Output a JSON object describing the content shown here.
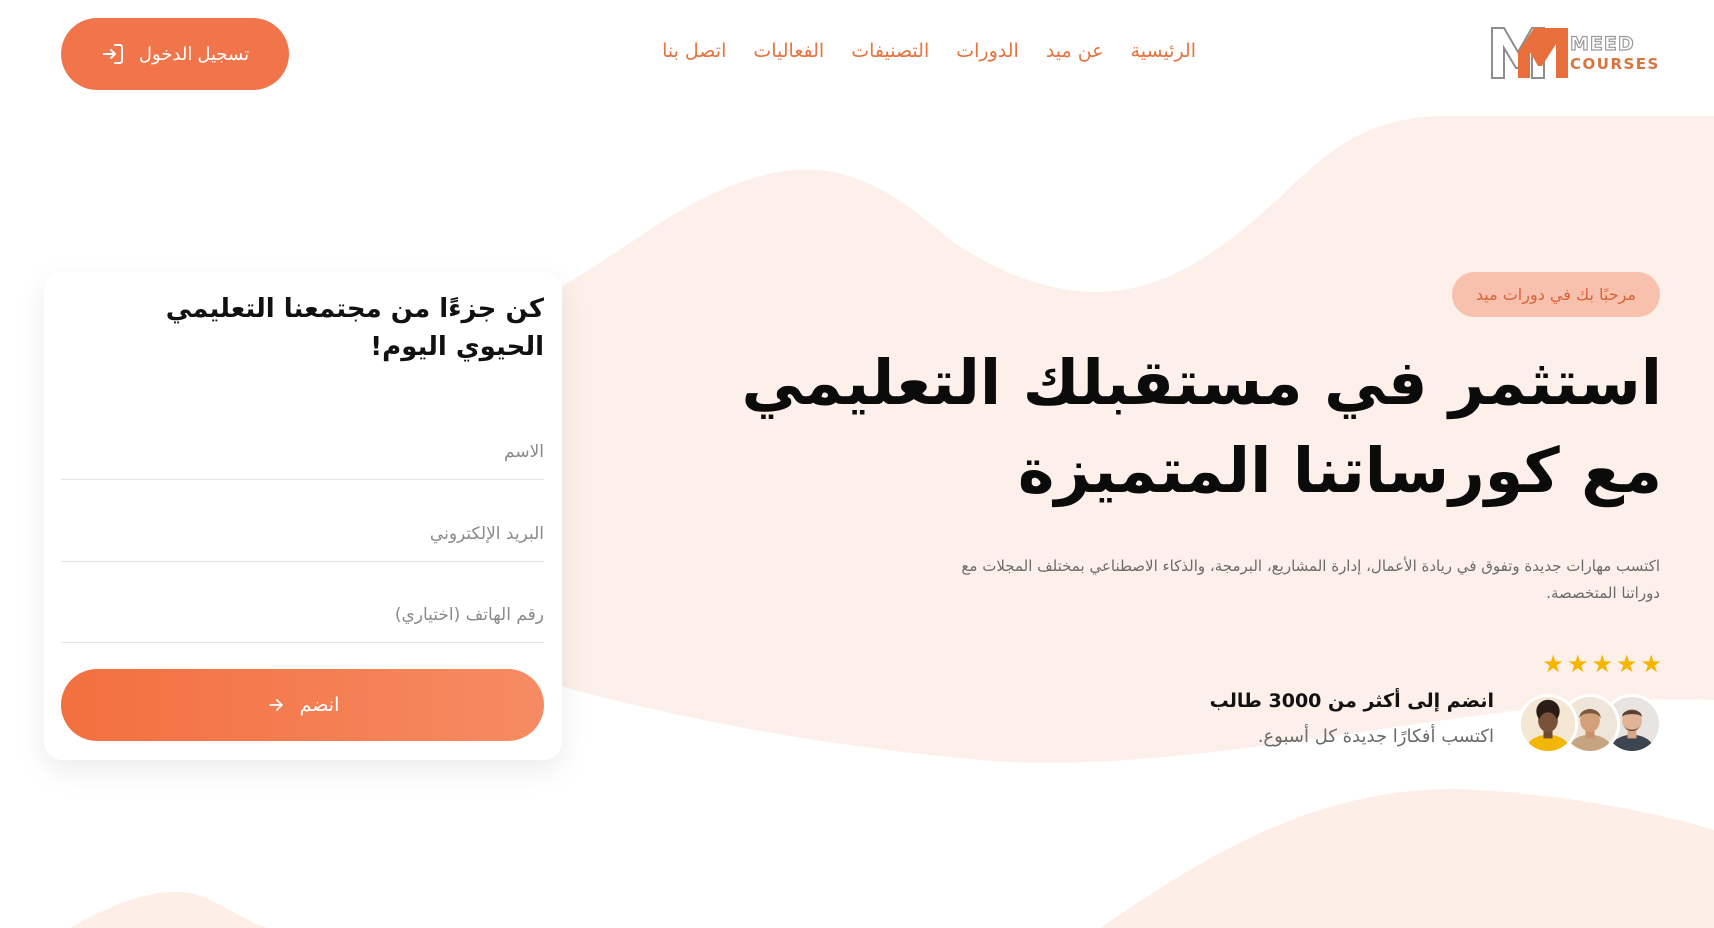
{
  "header": {
    "logo": {
      "line1": "MEED",
      "line2": "COURSES"
    },
    "nav": [
      {
        "label": "الرئيسية"
      },
      {
        "label": "عن ميد"
      },
      {
        "label": "الدورات"
      },
      {
        "label": "التصنيفات"
      },
      {
        "label": "الفعاليات"
      },
      {
        "label": "اتصل بنا"
      }
    ],
    "login_label": "تسجيل الدخول",
    "login_icon": "login-icon"
  },
  "hero": {
    "badge": "مرحبًا بك في دورات ميد",
    "headline_line1": "استثمر في مستقبلك التعليمي",
    "headline_line2": "مع كورساتنا المتميزة",
    "subtext": "اكتسب مهارات جديدة وتفوق في ريادة الأعمال، إدارة المشاريع، البرمجة، والذكاء الاصطناعي بمختلف المجلات مع دوراتنا المتخصصة."
  },
  "social_proof": {
    "rating": 5,
    "title": "انضم إلى أكثر من 3000 طالب",
    "subtitle": "اكتسب أفكارًا جديدة كل أسبوع."
  },
  "form": {
    "title": "كن جزءًا من مجتمعنا التعليمي الحيوي اليوم!",
    "name_placeholder": "الاسم",
    "email_placeholder": "البريد الإلكتروني",
    "phone_placeholder": "رقم الهاتف (اختياري)",
    "submit_label": "انضم",
    "submit_icon": "arrow-left-icon"
  },
  "colors": {
    "accent": "#f1744a",
    "nav_text": "#e8733f",
    "badge_bg": "#f8c1ad",
    "wave": "#fdeee8",
    "star": "#f7b500"
  }
}
